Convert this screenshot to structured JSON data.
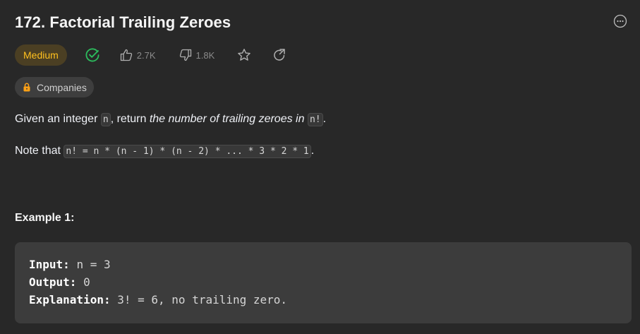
{
  "problem": {
    "title": "172. Factorial Trailing Zeroes",
    "difficulty": "Medium",
    "likes": "2.7K",
    "dislikes": "1.8K",
    "companies_label": "Companies"
  },
  "description": {
    "p1_prefix": "Given an integer ",
    "p1_var": "n",
    "p1_middle": ", return ",
    "p1_emph": "the number of trailing zeroes in ",
    "p1_code": "n!",
    "p1_suffix": ".",
    "p2_prefix": "Note that ",
    "p2_code": "n! = n * (n - 1) * (n - 2) * ... * 3 * 2 * 1",
    "p2_suffix": "."
  },
  "example": {
    "title": "Example 1:",
    "input_label": "Input:",
    "input_value": "n = 3",
    "output_label": "Output:",
    "output_value": "0",
    "explanation_label": "Explanation:",
    "explanation_value": "3! = 6, no trailing zero."
  },
  "colors": {
    "background": "#282828",
    "difficulty_text": "#ffc01e",
    "difficulty_bg": "#4b3f23",
    "solved_check": "#2cbb5d",
    "lock": "#ffa116"
  },
  "icons": [
    "more-icon",
    "solved-check-icon",
    "thumbs-up-icon",
    "thumbs-down-icon",
    "star-icon",
    "share-icon",
    "lock-icon"
  ]
}
